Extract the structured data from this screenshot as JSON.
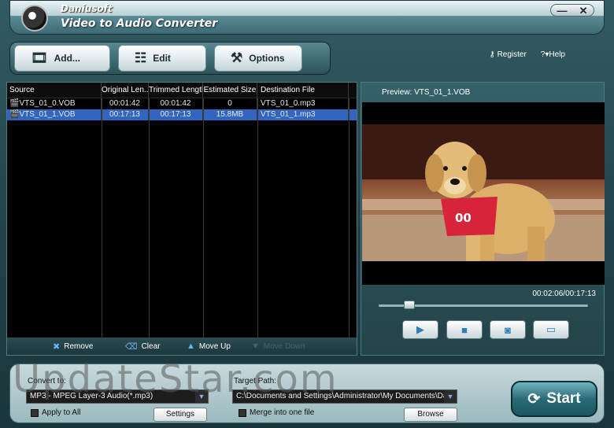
{
  "titlebar": {
    "brand": "Daniusoft",
    "title": "Video to Audio Converter",
    "minimize": "—",
    "close": "✕"
  },
  "toolbar": {
    "add_label": "Add...",
    "edit_label": "Edit",
    "options_label": "Options"
  },
  "links": {
    "register": "Register",
    "help": "Help"
  },
  "filelist": {
    "columns": [
      "Source",
      "Original Len...",
      "Trimmed Length",
      "Estimated Size",
      "Destination File"
    ],
    "rows": [
      {
        "source": "VTS_01_0.VOB",
        "original": "00:01:42",
        "trimmed": "00:01:42",
        "size": "0",
        "dest": "VTS_01_0.mp3",
        "selected": false
      },
      {
        "source": "VTS_01_1.VOB",
        "original": "00:17:13",
        "trimmed": "00:17:13",
        "size": "15.8MB",
        "dest": "VTS_01_1.mp3",
        "selected": true
      }
    ],
    "actions": {
      "remove": "Remove",
      "clear": "Clear",
      "move_up": "Move Up",
      "move_down": "Move Down"
    }
  },
  "preview": {
    "label": "Preview: VTS_01_1.VOB",
    "timecode": "00:02:06/00:17:13",
    "jersey_number": "00",
    "seek_fraction": 0.13
  },
  "convert": {
    "label": "Convert to:",
    "format": "MP3 - MPEG Layer-3 Audio(*.mp3)",
    "apply_all": "Apply to All",
    "settings": "Settings"
  },
  "target": {
    "label": "Target Path:",
    "path": "C:\\Documents and Settings\\Administrator\\My Documents\\Daniu",
    "merge": "Merge into one file",
    "browse": "Browse"
  },
  "start": {
    "label": "Start"
  },
  "watermark": "UpdateStar.com",
  "colors": {
    "accent": "#3265bf",
    "panel": "#234449",
    "start": "#2b6b77"
  }
}
